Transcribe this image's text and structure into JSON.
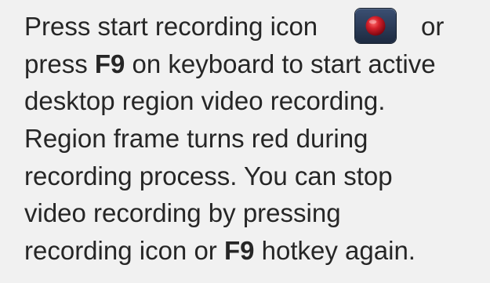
{
  "help": {
    "line1_text": "Press start recording icon",
    "line1_or": "or",
    "line2_pre": "press ",
    "line2_key": "F9",
    "line2_post": " on keyboard to start active",
    "line3": "desktop region video recording.",
    "line4": "Region frame turns red during",
    "line5": "recording process. You can stop",
    "line6": "video recording by pressing",
    "line7_pre": "recording icon or ",
    "line7_key": "F9",
    "line7_post": " hotkey again.",
    "record_icon": "record-button-icon",
    "colors": {
      "background": "#f1f1f1",
      "text": "#262626",
      "button": "#2b3a56",
      "record_dot": "#c8141e"
    }
  }
}
